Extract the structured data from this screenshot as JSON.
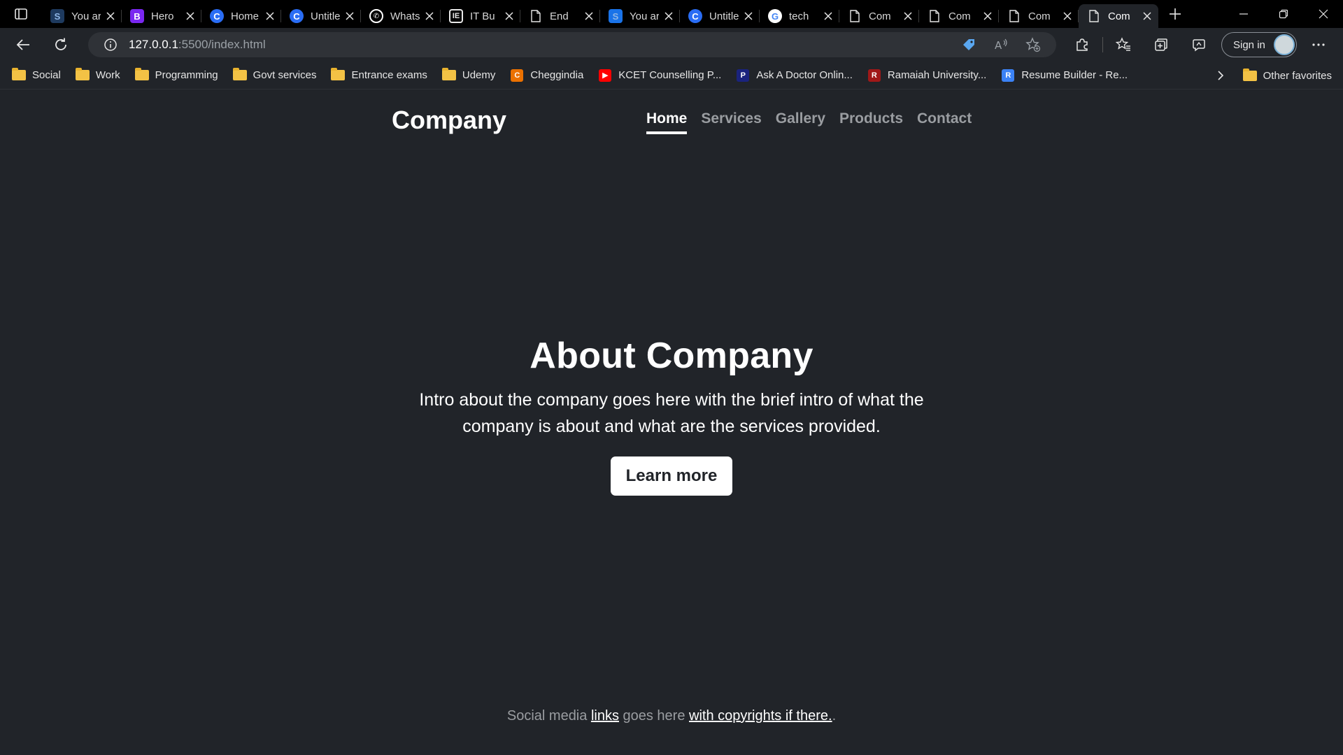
{
  "browser": {
    "tabs": [
      {
        "title": "You are",
        "icon": "s-favicon",
        "color": "#1e3a5f"
      },
      {
        "title": "Hero",
        "icon": "bootstrap-favicon",
        "color": "#7a27f0"
      },
      {
        "title": "Home",
        "icon": "c-favicon",
        "color": "#2a6df4"
      },
      {
        "title": "Untitled",
        "icon": "c-favicon",
        "color": "#2a6df4"
      },
      {
        "title": "WhatsApp",
        "icon": "whatsapp-favicon",
        "color": "#25d366"
      },
      {
        "title": "IT Bu",
        "icon": "ie-favicon",
        "color": "#e8e8e8"
      },
      {
        "title": "End",
        "icon": "page-favicon",
        "color": "#ffffff"
      },
      {
        "title": "You are",
        "icon": "s-favicon",
        "color": "#1a73e8"
      },
      {
        "title": "Untitled",
        "icon": "c-favicon",
        "color": "#2a6df4"
      },
      {
        "title": "tech",
        "icon": "google-favicon",
        "color": "#ffffff"
      },
      {
        "title": "Com",
        "icon": "page-favicon",
        "color": "#ffffff"
      },
      {
        "title": "Com",
        "icon": "page-favicon",
        "color": "#ffffff"
      },
      {
        "title": "Com",
        "icon": "page-favicon",
        "color": "#ffffff"
      },
      {
        "title": "Com",
        "icon": "page-favicon",
        "color": "#ffffff",
        "active": true
      }
    ],
    "address": {
      "host": "127.0.0.1",
      "path": ":5500/index.html"
    },
    "signin_label": "Sign in",
    "favorites": [
      {
        "label": "Social",
        "icon": "folder-icon"
      },
      {
        "label": "Work",
        "icon": "folder-icon"
      },
      {
        "label": "Programming",
        "icon": "folder-icon"
      },
      {
        "label": "Govt services",
        "icon": "folder-icon"
      },
      {
        "label": "Entrance exams",
        "icon": "folder-icon"
      },
      {
        "label": "Udemy",
        "icon": "folder-icon"
      },
      {
        "label": "Cheggindia",
        "icon": "chegg-icon"
      },
      {
        "label": "KCET Counselling P...",
        "icon": "youtube-icon"
      },
      {
        "label": "Ask A Doctor Onlin...",
        "icon": "practo-icon"
      },
      {
        "label": "Ramaiah University...",
        "icon": "ramaiah-icon"
      },
      {
        "label": "Resume Builder - Re...",
        "icon": "resume-icon"
      }
    ],
    "other_favorites_label": "Other favorites"
  },
  "site": {
    "brand": "Company",
    "nav": [
      "Home",
      "Services",
      "Gallery",
      "Products",
      "Contact"
    ],
    "hero": {
      "title": "About Company",
      "line1": "Intro about the company goes here with the brief intro of what the",
      "line2": "company is about and what are the services provided.",
      "cta": "Learn more"
    },
    "footer": {
      "text1": "Social media ",
      "link1": "links",
      "text2": " goes here ",
      "link2": "with copyrights if there.",
      "text3": "."
    }
  },
  "colors": {
    "page_bg": "#212429",
    "tab_strip_bg": "#000000",
    "muted_nav": "#9a9da1"
  }
}
